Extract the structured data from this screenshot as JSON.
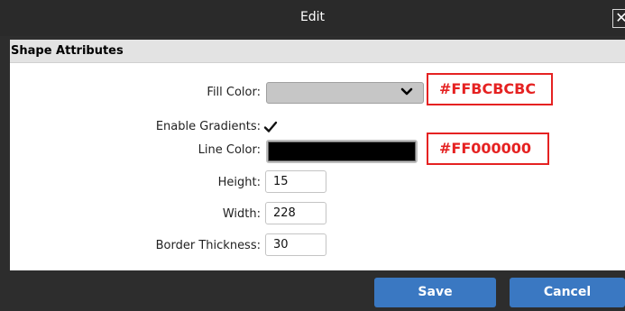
{
  "dialog": {
    "title": "Edit",
    "close_glyph": "✕"
  },
  "section": {
    "title": "Shape Attributes"
  },
  "fields": {
    "fill_color": {
      "label": "Fill Color:",
      "value_color": "#c6c6c6"
    },
    "enable_gradients": {
      "label": "Enable Gradients:",
      "checked": true
    },
    "line_color": {
      "label": "Line Color:",
      "value_color": "#000000"
    },
    "height": {
      "label": "Height:",
      "value": "15"
    },
    "width": {
      "label": "Width:",
      "value": "228"
    },
    "border_thickness": {
      "label": "Border Thickness:",
      "value": "30"
    }
  },
  "annotations": {
    "fill": "#FFBCBCBC",
    "line": "#FF000000"
  },
  "buttons": {
    "save": "Save",
    "cancel": "Cancel"
  },
  "icons": {
    "close": "close-icon",
    "dropdown": "chevron-down-icon",
    "check": "checkmark-icon"
  },
  "colors": {
    "title_bar": "#2a2a2a",
    "panel": "#ffffff",
    "button": "#3a78c2",
    "annotation": "#e52222"
  }
}
